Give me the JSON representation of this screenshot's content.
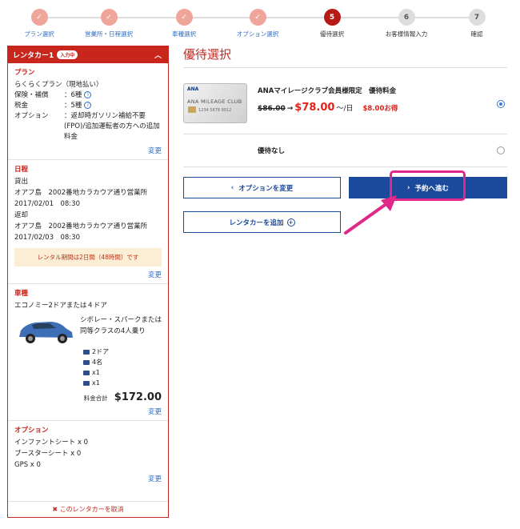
{
  "steps": [
    {
      "num": "✓",
      "label": "プラン選択",
      "state": "done"
    },
    {
      "num": "✓",
      "label": "営業所・日程選択",
      "state": "done"
    },
    {
      "num": "✓",
      "label": "車種選択",
      "state": "done"
    },
    {
      "num": "✓",
      "label": "オプション選択",
      "state": "done"
    },
    {
      "num": "5",
      "label": "優待選択",
      "state": "current"
    },
    {
      "num": "6",
      "label": "お客様情報入力",
      "state": "todo"
    },
    {
      "num": "7",
      "label": "確認",
      "state": "todo"
    }
  ],
  "sidebar": {
    "header": "レンタカー1",
    "badge": "入力中",
    "plan": {
      "title": "プラン",
      "name": "らくらくプラン（現地払い）",
      "insurance_label": "保険・補償",
      "insurance_value": "：6種",
      "tax_label": "税金",
      "tax_value": "：5種",
      "option_label": "オプション",
      "option_value": "：返却時ガソリン補給不要(FPO)/追加運転者の方への追加料金",
      "change": "変更"
    },
    "schedule": {
      "title": "日程",
      "pickup_label": "貸出",
      "pickup_place": "オアフ島　2002番地カラカウア通り営業所",
      "pickup_time": "2017/02/01　08:30",
      "return_label": "返却",
      "return_place": "オアフ島　2002番地カラカウア通り営業所",
      "return_time": "2017/02/03　08:30",
      "notice": "レンタル期間は2日間（48時間）です",
      "change": "変更"
    },
    "car": {
      "title": "車種",
      "class": "エコノミー2ドアまたは４ドア",
      "desc": "シボレー・スパークまたは同等クラスの4人乗り",
      "doors": "2ドア",
      "seats": "4名",
      "bags_large": "x1",
      "bags_small": "x1",
      "total_label": "料金合計",
      "total_value": "$172.00",
      "change": "変更"
    },
    "options": {
      "title": "オプション",
      "infant": "インファントシート x 0",
      "booster": "ブースターシート x 0",
      "gps": "GPS x 0",
      "change": "変更"
    },
    "cancel": "✖ このレンタカーを取消"
  },
  "main": {
    "title": "優待選択",
    "offer": {
      "title": "ANAマイレージクラブ会員様限定　優待料金",
      "old_price": "$86.00",
      "arrow": "→",
      "new_price": "$78.00",
      "per": "〜/日",
      "save": "$8.00お得",
      "card_brand": "ANA",
      "card_name": "ANA MILEAGE CLUB",
      "card_number": "1234 5678 9012"
    },
    "no_offer": "優待なし",
    "back_button": "オプションを変更",
    "next_button": "予約へ進む",
    "add_button": "レンタカーを追加"
  }
}
